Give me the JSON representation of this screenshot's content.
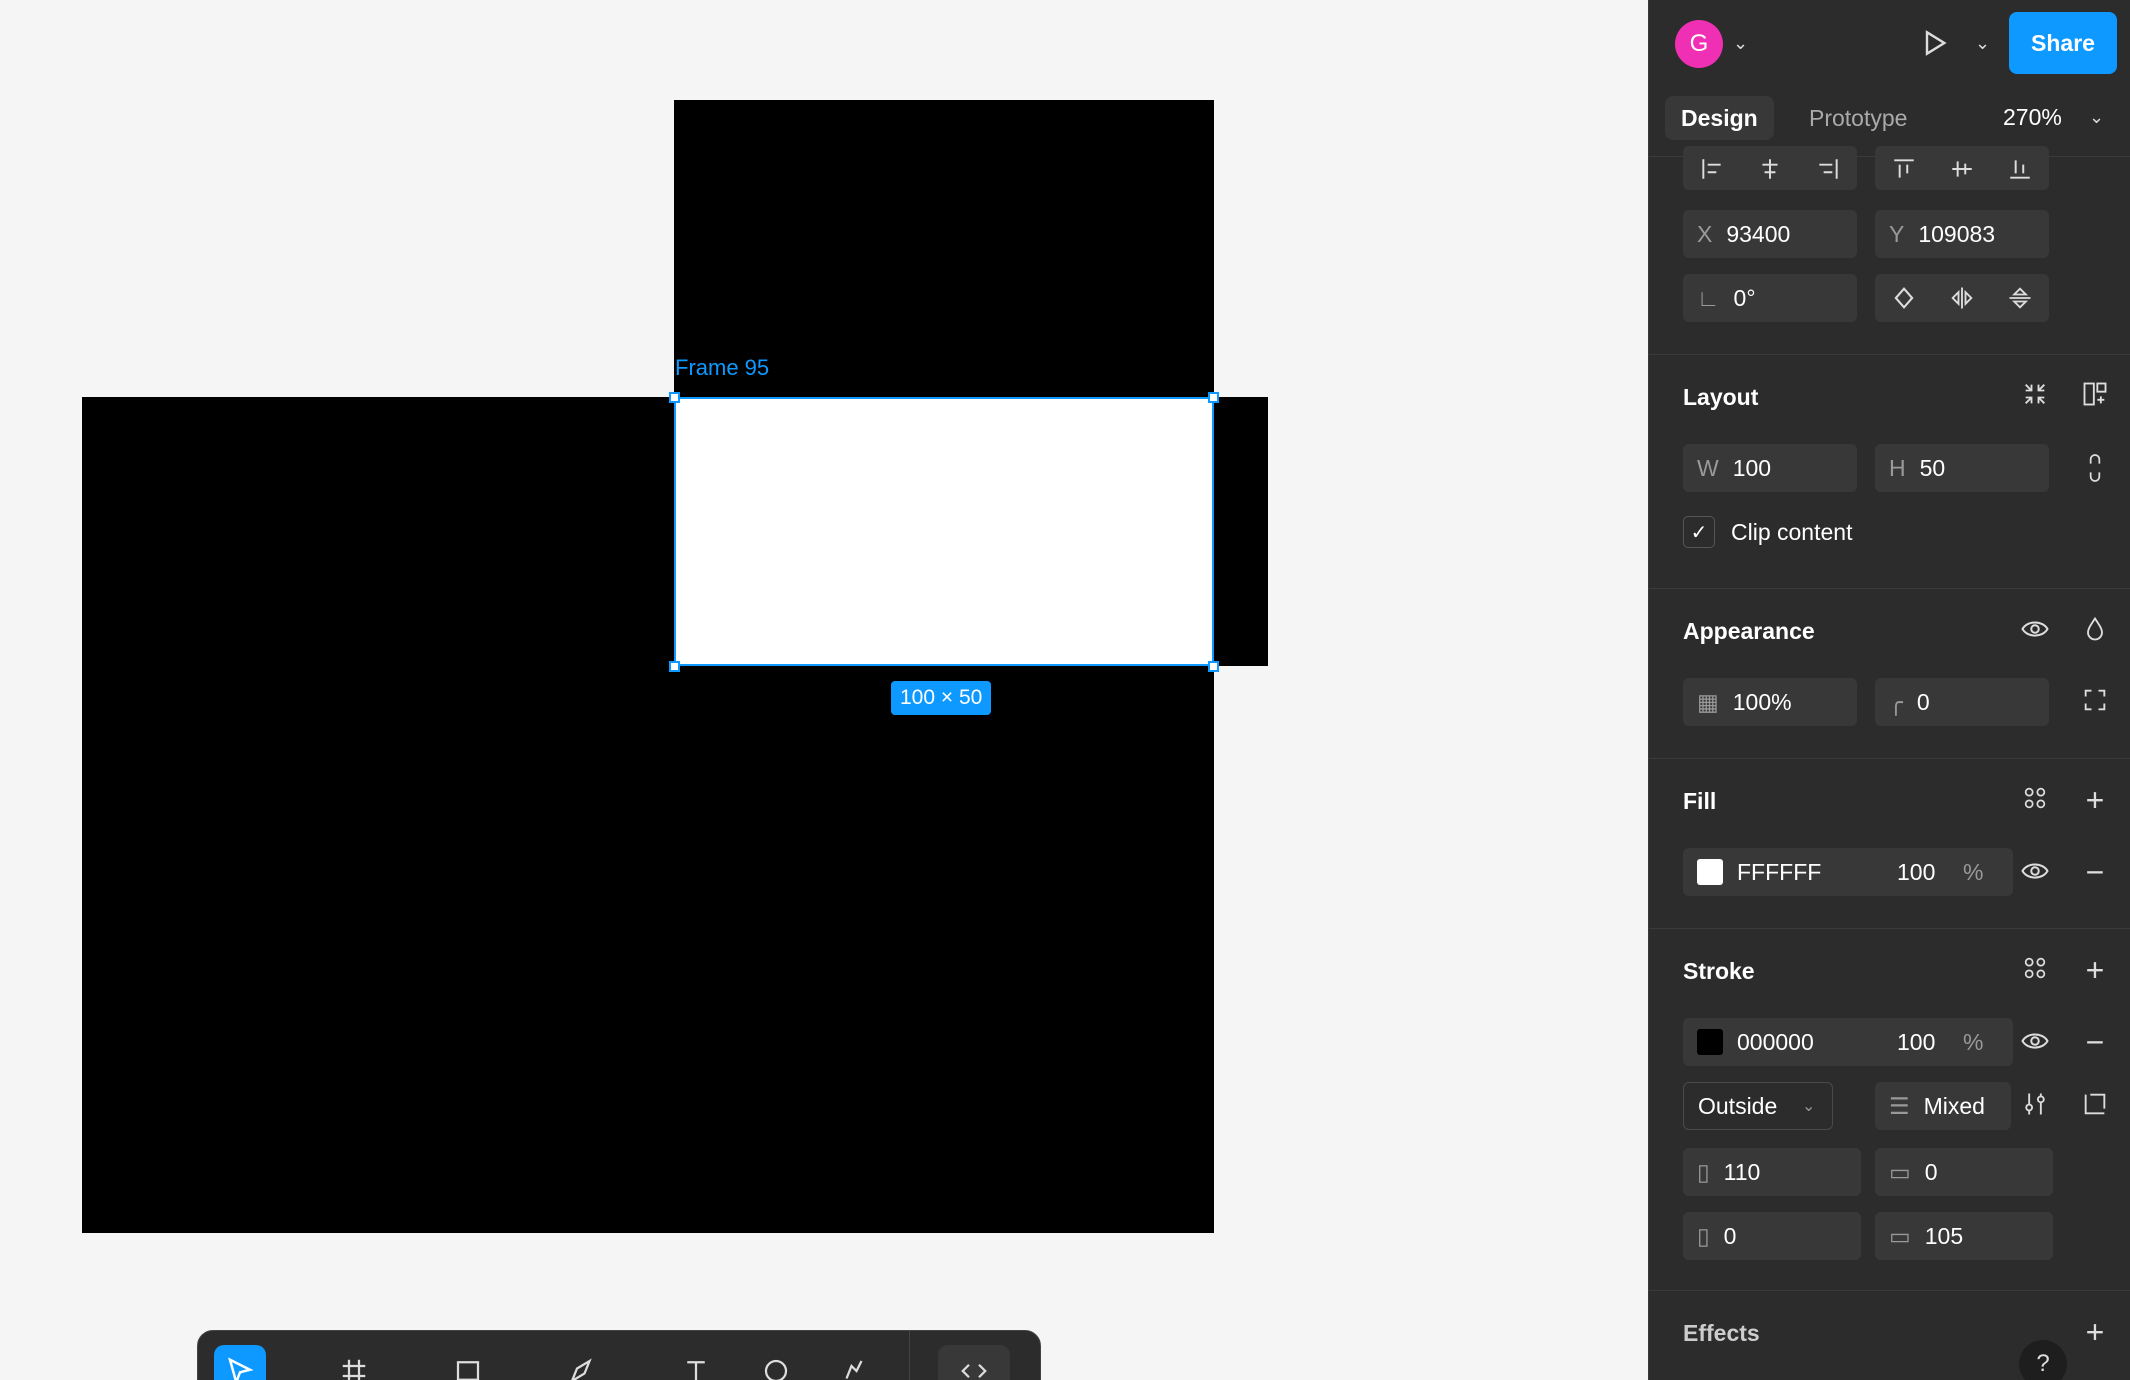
{
  "canvas": {
    "frame_label": "Frame 95",
    "size_badge": "100 × 50"
  },
  "toolbar": {
    "tools": [
      "move-tool",
      "frame-tool",
      "rectangle-tool",
      "pen-tool",
      "text-tool",
      "ellipse-tool",
      "actions-tool",
      "dev-mode-toggle"
    ],
    "active": "move-tool"
  },
  "header": {
    "avatar_initial": "G",
    "share_label": "Share",
    "tabs": [
      "Design",
      "Prototype"
    ],
    "active_tab": "Design",
    "zoom": "270%"
  },
  "position": {
    "x_label": "X",
    "x_value": "93400",
    "y_label": "Y",
    "y_value": "109083",
    "rotation": "0°"
  },
  "layout": {
    "title": "Layout",
    "w_label": "W",
    "w_value": "100",
    "h_label": "H",
    "h_value": "50",
    "clip_label": "Clip content",
    "clip_checked": true
  },
  "appearance": {
    "title": "Appearance",
    "opacity": "100%",
    "radius": "0"
  },
  "fill": {
    "title": "Fill",
    "hex": "FFFFFF",
    "opacity": "100",
    "unit": "%",
    "color": "#ffffff"
  },
  "stroke": {
    "title": "Stroke",
    "hex": "000000",
    "opacity": "100",
    "unit": "%",
    "color": "#000000",
    "position": "Outside",
    "weight_mode": "Mixed",
    "left": "110",
    "top": "0",
    "right": "0",
    "bottom": "105"
  },
  "effects": {
    "title": "Effects"
  },
  "help": "?"
}
